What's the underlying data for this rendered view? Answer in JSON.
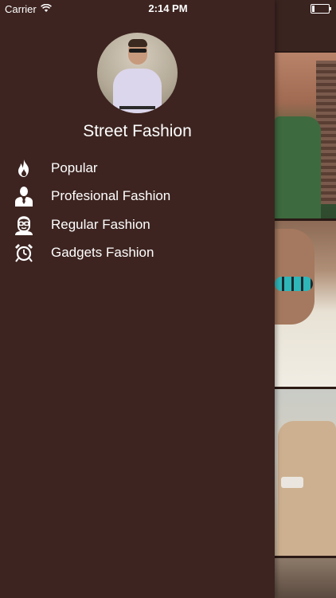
{
  "status_bar": {
    "carrier": "Carrier",
    "time": "2:14 PM"
  },
  "drawer": {
    "title": "Street Fashion",
    "items": [
      {
        "label": "Popular",
        "icon": "flame-icon"
      },
      {
        "label": "Profesional Fashion",
        "icon": "businessman-icon"
      },
      {
        "label": "Regular Fashion",
        "icon": "nerd-face-icon"
      },
      {
        "label": "Gadgets Fashion",
        "icon": "watch-icon"
      }
    ]
  },
  "colors": {
    "drawer_background": "#3d2420",
    "text": "#ffffff"
  }
}
